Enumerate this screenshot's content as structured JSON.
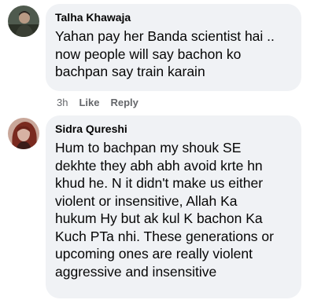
{
  "comments": [
    {
      "author": "Talha Khawaja",
      "text": "Yahan pay her Banda scientist hai ..\nnow people will say bachon ko\nbachpan say train karain",
      "time": "3h",
      "like_label": "Like",
      "reply_label": "Reply",
      "avatar_icon": "profile-photo"
    },
    {
      "author": "Sidra Qureshi",
      "text": "Hum to bachpan my shouk SE\ndekhte they abh abh avoid krte hn\nkhud he. N it didn't make us either\nviolent or insensitive, Allah Ka\nhukum Hy but ak kul K bachon Ka\nKuch PTa nhi. These generations or\nupcoming ones are really violent\naggressive and insensitive",
      "avatar_icon": "profile-photo"
    }
  ],
  "colors": {
    "bubble": "#f0f2f5",
    "text": "#050505",
    "meta": "#65676b"
  }
}
